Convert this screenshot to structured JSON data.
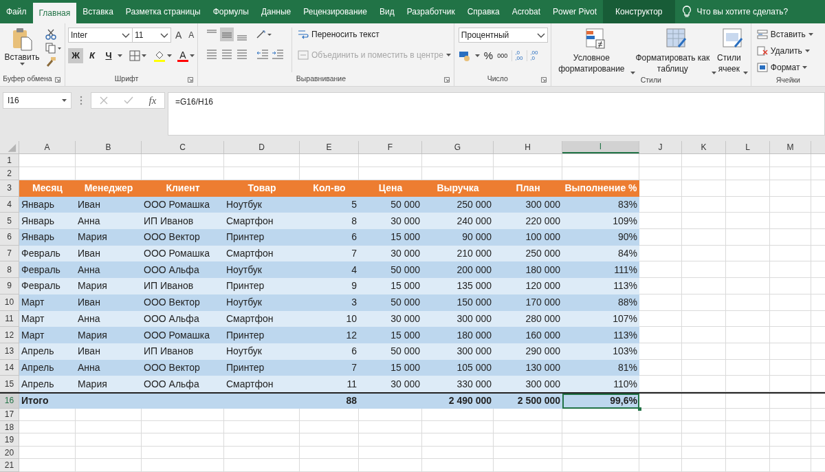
{
  "menu_tabs": [
    {
      "label": "Файл",
      "selected": false,
      "contextual": false
    },
    {
      "label": "Главная",
      "selected": true,
      "contextual": false
    },
    {
      "label": "Вставка",
      "selected": false,
      "contextual": false
    },
    {
      "label": "Разметка страницы",
      "selected": false,
      "contextual": false
    },
    {
      "label": "Формулы",
      "selected": false,
      "contextual": false
    },
    {
      "label": "Данные",
      "selected": false,
      "contextual": false
    },
    {
      "label": "Рецензирование",
      "selected": false,
      "contextual": false
    },
    {
      "label": "Вид",
      "selected": false,
      "contextual": false
    },
    {
      "label": "Разработчик",
      "selected": false,
      "contextual": false
    },
    {
      "label": "Справка",
      "selected": false,
      "contextual": false
    },
    {
      "label": "Acrobat",
      "selected": false,
      "contextual": false
    },
    {
      "label": "Power Pivot",
      "selected": false,
      "contextual": false
    },
    {
      "label": "Конструктор",
      "selected": false,
      "contextual": true
    }
  ],
  "tell_me": "Что вы хотите сделать?",
  "clipboard": {
    "paste": "Вставить",
    "group_label": "Буфер обмена"
  },
  "font": {
    "font_name": "Inter",
    "font_size": "11",
    "grow": "A",
    "shrink": "A",
    "bold": {
      "label": "Ж",
      "on": true
    },
    "italic": {
      "label": "К",
      "on": false
    },
    "underline": {
      "label": "Ч",
      "on": false
    },
    "font_color": "A",
    "group_label": "Шрифт"
  },
  "alignment": {
    "wrap_text": "Переносить текст",
    "merge": {
      "label": "Объединить и поместить в центре",
      "disabled": true
    },
    "top_align": {
      "selected": false
    },
    "middle_align": {
      "selected": true
    },
    "bottom_align": {
      "selected": false
    },
    "group_label": "Выравнивание"
  },
  "number": {
    "format": "Процентный",
    "percent": "%",
    "thousands": "000",
    "increase_decimal": [
      ",0",
      ",00"
    ],
    "decrease_decimal": [
      ",00",
      ",0"
    ],
    "group_label": "Число"
  },
  "styles": {
    "buttons": [
      "Условное форматирование",
      "Форматировать как таблицу",
      "Стили ячеек"
    ],
    "group_label": "Стили"
  },
  "cells": {
    "buttons": [
      "Вставить",
      "Удалить",
      "Формат"
    ],
    "group_label": "Ячейки"
  },
  "formula_bar": {
    "name_box": "I16",
    "fx": "fx",
    "formula": "=G16/H16"
  },
  "sheet": {
    "columns": [
      {
        "label": "A",
        "selected": false
      },
      {
        "label": "B",
        "selected": false
      },
      {
        "label": "C",
        "selected": false
      },
      {
        "label": "D",
        "selected": false
      },
      {
        "label": "E",
        "selected": false
      },
      {
        "label": "F",
        "selected": false
      },
      {
        "label": "G",
        "selected": false
      },
      {
        "label": "H",
        "selected": false
      },
      {
        "label": "I",
        "selected": true
      },
      {
        "label": "J",
        "selected": false
      },
      {
        "label": "K",
        "selected": false
      },
      {
        "label": "L",
        "selected": false
      },
      {
        "label": "M",
        "selected": false
      }
    ],
    "rows": [
      {
        "number": "1",
        "kind": "empty",
        "selected": false
      },
      {
        "number": "2",
        "kind": "empty",
        "selected": false
      },
      {
        "number": "3",
        "kind": "header",
        "selected": false,
        "cells": [
          "Месяц",
          "Менеджер",
          "Клиент",
          "Товар",
          "Кол-во",
          "Цена",
          "Выручка",
          "План",
          "Выполнение %"
        ]
      },
      {
        "number": "4",
        "kind": "band",
        "selected": false,
        "cells": [
          "Январь",
          "Иван",
          "ООО Ромашка",
          "Ноутбук",
          "5",
          "50 000",
          "250 000",
          "300 000",
          "83%"
        ]
      },
      {
        "number": "5",
        "kind": "band_alt",
        "selected": false,
        "cells": [
          "Январь",
          "Анна",
          "ИП Иванов",
          "Смартфон",
          "8",
          "30 000",
          "240 000",
          "220 000",
          "109%"
        ]
      },
      {
        "number": "6",
        "kind": "band",
        "selected": false,
        "cells": [
          "Январь",
          "Мария",
          "ООО Вектор",
          "Принтер",
          "6",
          "15 000",
          "90 000",
          "100 000",
          "90%"
        ]
      },
      {
        "number": "7",
        "kind": "band_alt",
        "selected": false,
        "cells": [
          "Февраль",
          "Иван",
          "ООО Ромашка",
          "Смартфон",
          "7",
          "30 000",
          "210 000",
          "250 000",
          "84%"
        ]
      },
      {
        "number": "8",
        "kind": "band",
        "selected": false,
        "cells": [
          "Февраль",
          "Анна",
          "ООО Альфа",
          "Ноутбук",
          "4",
          "50 000",
          "200 000",
          "180 000",
          "111%"
        ]
      },
      {
        "number": "9",
        "kind": "band_alt",
        "selected": false,
        "cells": [
          "Февраль",
          "Мария",
          "ИП Иванов",
          "Принтер",
          "9",
          "15 000",
          "135 000",
          "120 000",
          "113%"
        ]
      },
      {
        "number": "10",
        "kind": "band",
        "selected": false,
        "cells": [
          "Март",
          "Иван",
          "ООО Вектор",
          "Ноутбук",
          "3",
          "50 000",
          "150 000",
          "170 000",
          "88%"
        ]
      },
      {
        "number": "11",
        "kind": "band_alt",
        "selected": false,
        "cells": [
          "Март",
          "Анна",
          "ООО Альфа",
          "Смартфон",
          "10",
          "30 000",
          "300 000",
          "280 000",
          "107%"
        ]
      },
      {
        "number": "12",
        "kind": "band",
        "selected": false,
        "cells": [
          "Март",
          "Мария",
          "ООО Ромашка",
          "Принтер",
          "12",
          "15 000",
          "180 000",
          "160 000",
          "113%"
        ]
      },
      {
        "number": "13",
        "kind": "band_alt",
        "selected": false,
        "cells": [
          "Апрель",
          "Иван",
          "ИП Иванов",
          "Ноутбук",
          "6",
          "50 000",
          "300 000",
          "290 000",
          "103%"
        ]
      },
      {
        "number": "14",
        "kind": "band",
        "selected": false,
        "cells": [
          "Апрель",
          "Анна",
          "ООО Вектор",
          "Принтер",
          "7",
          "15 000",
          "105 000",
          "130 000",
          "81%"
        ]
      },
      {
        "number": "15",
        "kind": "band_alt",
        "selected": false,
        "cells": [
          "Апрель",
          "Мария",
          "ООО Альфа",
          "Смартфон",
          "11",
          "30 000",
          "330 000",
          "300 000",
          "110%"
        ]
      },
      {
        "number": "16",
        "kind": "total",
        "selected": true,
        "cells": [
          {
            "text": "Итого",
            "selected": false
          },
          null,
          null,
          null,
          {
            "text": "88",
            "selected": false
          },
          null,
          {
            "text": "2 490 000",
            "selected": false
          },
          {
            "text": "2 500 000",
            "selected": false
          },
          {
            "text": "99,6%",
            "selected": true
          }
        ]
      },
      {
        "number": "17",
        "kind": "empty",
        "selected": false
      },
      {
        "number": "18",
        "kind": "empty",
        "selected": false
      },
      {
        "number": "19",
        "kind": "empty",
        "selected": false
      },
      {
        "number": "20",
        "kind": "empty",
        "selected": false
      },
      {
        "number": "21",
        "kind": "empty",
        "selected": false
      }
    ]
  }
}
